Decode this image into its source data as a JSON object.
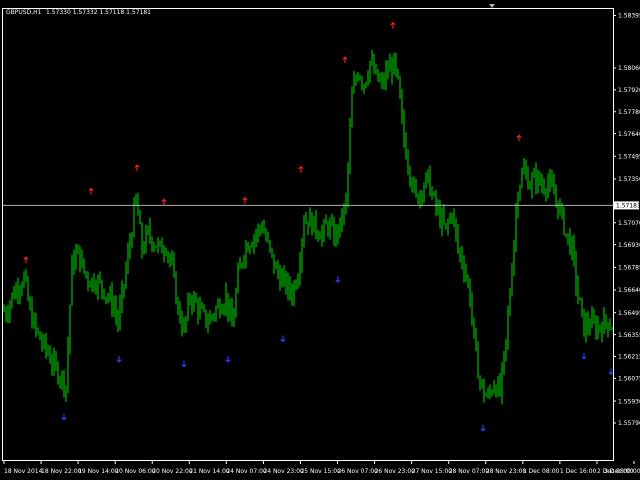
{
  "header": {
    "symbol_timeframe": "GBPUSD,H1",
    "ohlc": "1.57330 1.57332 1.57118 1.57181"
  },
  "colors": {
    "background": "#000000",
    "candle": "#00e000",
    "grid_and_axis": "#ffffff",
    "fractal_up": "#ff2020",
    "fractal_down": "#3040ff",
    "bid_line": "#b0b0b0",
    "price_tag_bg": "#ffffff"
  },
  "icons": {
    "scroll_marker": "triangle-down-icon",
    "fractal_up": "up-arrow-icon",
    "fractal_down": "down-arrow-icon"
  },
  "chart_data": {
    "type": "candlestick",
    "ylim": [
      1.5555,
      1.5844
    ],
    "y_ticks": [
      "1.58395",
      "1.58060",
      "1.57920",
      "1.57780",
      "1.57640",
      "1.57495",
      "1.57350",
      "1.57181",
      "1.57070",
      "1.56930",
      "1.56785",
      "1.56640",
      "1.56495",
      "1.56355",
      "1.56215",
      "1.56075",
      "1.55930",
      "1.55790"
    ],
    "x_ticks": [
      "18 Nov 2014",
      "18 Nov 22:00",
      "19 Nov 14:00",
      "20 Nov 06:00",
      "20 Nov 22:00",
      "21 Nov 14:00",
      "24 Nov 07:00",
      "24 Nov 23:00",
      "25 Nov 15:00",
      "26 Nov 07:00",
      "26 Nov 23:00",
      "27 Nov 15:00",
      "28 Nov 07:00",
      "28 Nov 23:00",
      "1 Dec 08:00",
      "1 Dec 16:00",
      "2 Dec 08:00",
      "3 Dec 00:00"
    ],
    "current_price": "1.57181",
    "close_path": [
      [
        0,
        1.5652
      ],
      [
        6,
        1.565
      ],
      [
        12,
        1.566
      ],
      [
        18,
        1.5667
      ],
      [
        24,
        1.5672
      ],
      [
        30,
        1.565
      ],
      [
        36,
        1.5638
      ],
      [
        42,
        1.563
      ],
      [
        48,
        1.5624
      ],
      [
        54,
        1.5615
      ],
      [
        60,
        1.561
      ],
      [
        66,
        1.5603
      ],
      [
        72,
        1.568
      ],
      [
        78,
        1.5688
      ],
      [
        84,
        1.5676
      ],
      [
        90,
        1.567
      ],
      [
        96,
        1.567
      ],
      [
        102,
        1.5666
      ],
      [
        108,
        1.566
      ],
      [
        114,
        1.5654
      ],
      [
        118,
        1.5643
      ],
      [
        124,
        1.5668
      ],
      [
        130,
        1.5695
      ],
      [
        136,
        1.5722
      ],
      [
        142,
        1.569
      ],
      [
        148,
        1.57
      ],
      [
        154,
        1.5695
      ],
      [
        160,
        1.569
      ],
      [
        166,
        1.5693
      ],
      [
        172,
        1.5678
      ],
      [
        178,
        1.5652
      ],
      [
        184,
        1.5638
      ],
      [
        190,
        1.566
      ],
      [
        196,
        1.5655
      ],
      [
        202,
        1.5648
      ],
      [
        208,
        1.5644
      ],
      [
        214,
        1.565
      ],
      [
        220,
        1.5655
      ],
      [
        226,
        1.566
      ],
      [
        232,
        1.564
      ],
      [
        238,
        1.5672
      ],
      [
        244,
        1.569
      ],
      [
        250,
        1.5696
      ],
      [
        256,
        1.57
      ],
      [
        262,
        1.5706
      ],
      [
        268,
        1.5692
      ],
      [
        274,
        1.568
      ],
      [
        280,
        1.5672
      ],
      [
        286,
        1.5667
      ],
      [
        292,
        1.5662
      ],
      [
        298,
        1.5676
      ],
      [
        304,
        1.571
      ],
      [
        310,
        1.5708
      ],
      [
        316,
        1.5704
      ],
      [
        322,
        1.57
      ],
      [
        328,
        1.5706
      ],
      [
        334,
        1.5698
      ],
      [
        340,
        1.5705
      ],
      [
        346,
        1.572
      ],
      [
        352,
        1.5788
      ],
      [
        358,
        1.5805
      ],
      [
        364,
        1.5796
      ],
      [
        370,
        1.581
      ],
      [
        376,
        1.58
      ],
      [
        382,
        1.5795
      ],
      [
        388,
        1.5805
      ],
      [
        394,
        1.5808
      ],
      [
        398,
        1.5795
      ],
      [
        404,
        1.576
      ],
      [
        410,
        1.574
      ],
      [
        416,
        1.5722
      ],
      [
        422,
        1.573
      ],
      [
        428,
        1.5735
      ],
      [
        434,
        1.572
      ],
      [
        440,
        1.571
      ],
      [
        446,
        1.5702
      ],
      [
        452,
        1.5715
      ],
      [
        458,
        1.569
      ],
      [
        464,
        1.568
      ],
      [
        470,
        1.566
      ],
      [
        476,
        1.562
      ],
      [
        482,
        1.56
      ],
      [
        488,
        1.5595
      ],
      [
        494,
        1.5605
      ],
      [
        500,
        1.5598
      ],
      [
        506,
        1.563
      ],
      [
        512,
        1.568
      ],
      [
        518,
        1.573
      ],
      [
        524,
        1.574
      ],
      [
        530,
        1.5732
      ],
      [
        536,
        1.5736
      ],
      [
        542,
        1.5731
      ],
      [
        548,
        1.5733
      ],
      [
        554,
        1.5725
      ],
      [
        560,
        1.5715
      ],
      [
        566,
        1.57
      ],
      [
        572,
        1.569
      ],
      [
        578,
        1.566
      ],
      [
        584,
        1.564
      ],
      [
        590,
        1.5643
      ],
      [
        596,
        1.564
      ],
      [
        602,
        1.5642
      ],
      [
        608,
        1.5644
      ],
      [
        614,
        1.5639
      ]
    ],
    "fractals_up": [
      {
        "px": 26,
        "price": 1.5683
      },
      {
        "px": 91,
        "price": 1.5727
      },
      {
        "px": 137,
        "price": 1.5742
      },
      {
        "px": 164,
        "price": 1.572
      },
      {
        "px": 245,
        "price": 1.5721
      },
      {
        "px": 301,
        "price": 1.5741
      },
      {
        "px": 345,
        "price": 1.5811
      },
      {
        "px": 393,
        "price": 1.5833
      },
      {
        "px": 519,
        "price": 1.5761
      }
    ],
    "fractals_down": [
      {
        "px": 64,
        "price": 1.5583
      },
      {
        "px": 119,
        "price": 1.562
      },
      {
        "px": 184,
        "price": 1.5617
      },
      {
        "px": 228,
        "price": 1.562
      },
      {
        "px": 283,
        "price": 1.5633
      },
      {
        "px": 338,
        "price": 1.5671
      },
      {
        "px": 483,
        "price": 1.5576
      },
      {
        "px": 584,
        "price": 1.5622
      },
      {
        "px": 611,
        "price": 1.5612
      }
    ]
  }
}
